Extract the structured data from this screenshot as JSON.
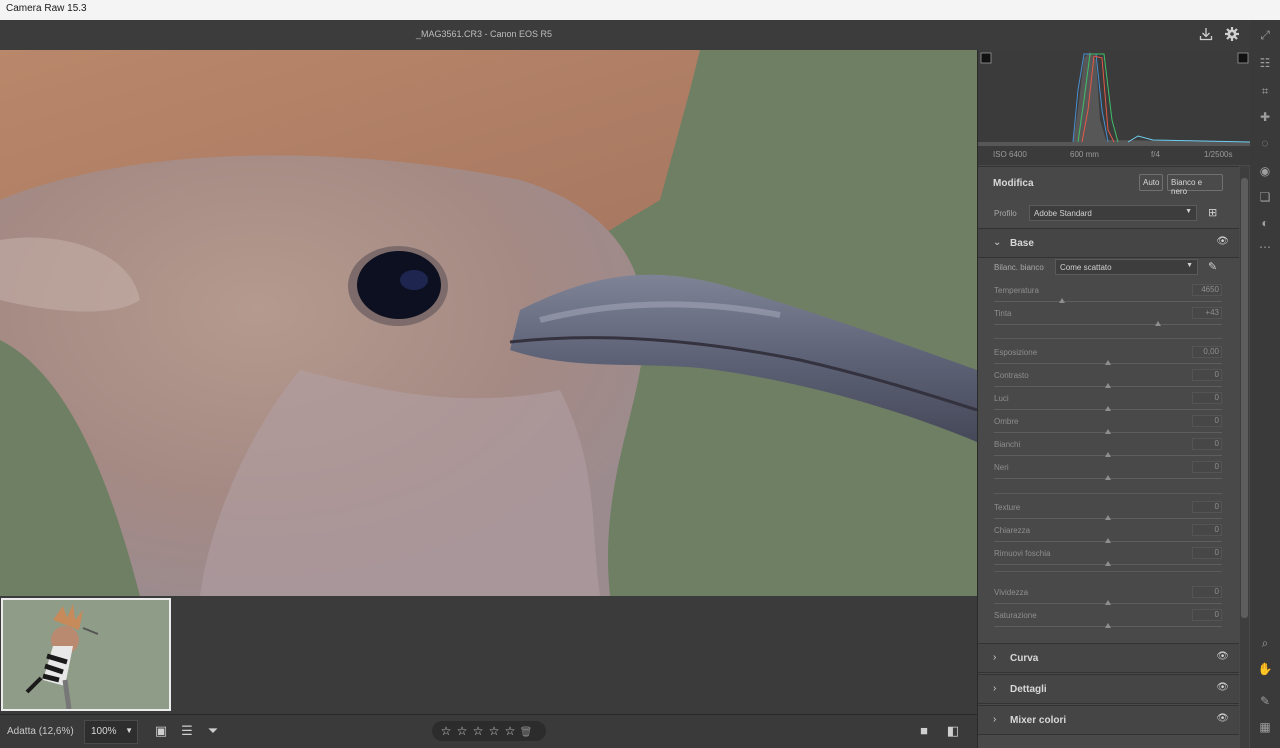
{
  "window": {
    "title": "Camera Raw 15.3"
  },
  "header": {
    "filename": "_MAG3561.CR3  -  Canon EOS R5"
  },
  "histogram": {
    "exif": {
      "iso": "ISO 6400",
      "focal": "600 mm",
      "aperture": "f/4",
      "shutter": "1/2500s"
    }
  },
  "edit": {
    "title": "Modifica",
    "auto_label": "Auto",
    "bw_label": "Bianco e nero",
    "profile_label": "Profilo",
    "profile_value": "Adobe Standard"
  },
  "base": {
    "title": "Base",
    "wb_label": "Bilanc. bianco",
    "wb_value": "Come scattato",
    "temp": {
      "name": "Temperatura",
      "value": "4650",
      "pos": 0.3
    },
    "tint": {
      "name": "Tinta",
      "value": "+43",
      "pos": 0.72
    },
    "exposure": {
      "name": "Esposizione",
      "value": "0,00",
      "pos": 0.5
    },
    "contrast": {
      "name": "Contrasto",
      "value": "0",
      "pos": 0.5
    },
    "highlights": {
      "name": "Luci",
      "value": "0",
      "pos": 0.5
    },
    "shadows": {
      "name": "Ombre",
      "value": "0",
      "pos": 0.5
    },
    "whites": {
      "name": "Bianchi",
      "value": "0",
      "pos": 0.5
    },
    "blacks": {
      "name": "Neri",
      "value": "0",
      "pos": 0.5
    },
    "texture": {
      "name": "Texture",
      "value": "0",
      "pos": 0.5
    },
    "clarity": {
      "name": "Chiarezza",
      "value": "0",
      "pos": 0.5
    },
    "dehaze": {
      "name": "Rimuovi foschia",
      "value": "0",
      "pos": 0.5
    },
    "vibrance": {
      "name": "Vividezza",
      "value": "0",
      "pos": 0.5
    },
    "saturation": {
      "name": "Saturazione",
      "value": "0",
      "pos": 0.5
    }
  },
  "sections": {
    "curve": "Curva",
    "detail": "Dettagli",
    "mixer": "Mixer colori"
  },
  "bottom": {
    "fit_label": "Adatta (12,6%)",
    "zoom_value": "100%"
  },
  "colors": {
    "panel": "#494949",
    "background": "#6f7f63"
  }
}
